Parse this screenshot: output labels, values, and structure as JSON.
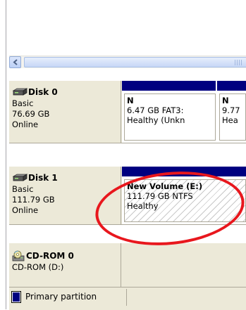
{
  "scrollbar": {
    "left_arrow": "<",
    "grip": "|||"
  },
  "disks": [
    {
      "name": "Disk 0",
      "type": "Basic",
      "size": "76.69 GB",
      "status": "Online",
      "partitions": [
        {
          "title": "N",
          "detail": "6.47 GB FAT3:",
          "state": "Healthy (Unkn"
        },
        {
          "title": "N",
          "detail": "9.77",
          "state": "Hea"
        }
      ]
    },
    {
      "name": "Disk 1",
      "type": "Basic",
      "size": "111.79 GB",
      "status": "Online",
      "partitions": [
        {
          "title": "New Volume  (E:)",
          "detail": "111.79 GB NTFS",
          "state": "Healthy"
        }
      ]
    }
  ],
  "cdrom": {
    "name": "CD-ROM 0",
    "drive": "CD-ROM (D:)"
  },
  "legend": {
    "primary_label": "Primary partition"
  },
  "colors": {
    "partition_bar": "#000080",
    "highlight": "#e8171d",
    "panel": "#ece9d8"
  },
  "icons": {
    "disk": "hard-disk-icon",
    "cdrom": "cd-rom-icon",
    "scroll_left": "scroll-left-arrow-icon"
  }
}
